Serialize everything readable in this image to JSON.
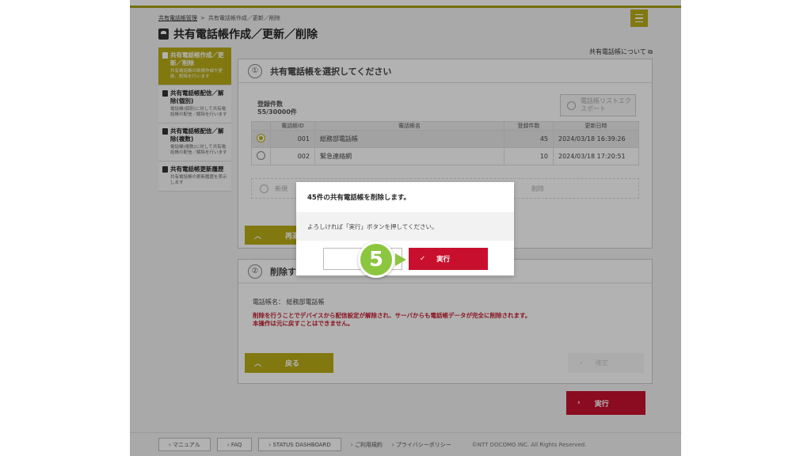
{
  "breadcrumb": {
    "root": "共有電話帳管理",
    "current": "共有電話帳作成／更新／削除"
  },
  "page": {
    "title": "共有電話帳作成／更新／削除"
  },
  "help_link": "共有電話帳について",
  "sidebar": {
    "items": [
      {
        "label": "共有電話帳作成／更新／削除",
        "desc": "共有電話帳の新規作成や更新、削除を行います",
        "active": true
      },
      {
        "label": "共有電話帳配信／解除(個別)",
        "desc": "電話機(個別)に対して共有電話帳の配信／解除を行います",
        "active": false
      },
      {
        "label": "共有電話帳配信／解除(複数)",
        "desc": "電話機(複数)に対して共有電話帳の配信／解除を行います",
        "active": false
      },
      {
        "label": "共有電話帳更新履歴",
        "desc": "共有電話帳の更新履歴を表示します",
        "active": false
      }
    ]
  },
  "panel1": {
    "step": "①",
    "title": "共有電話帳を選択してください",
    "count_title": "登録件数",
    "count_value": "55/30000件",
    "export_label": "電話帳リストエクスポート",
    "table": {
      "headers": [
        "電話帳ID",
        "電話帳名",
        "登録件数",
        "更新日時"
      ],
      "rows": [
        {
          "id": "001",
          "name": "総務部電話帳",
          "count": "45",
          "updated": "2024/03/18 16:39:26",
          "selected": true
        },
        {
          "id": "002",
          "name": "緊急連絡網",
          "count": "10",
          "updated": "2024/03/18 17:20:51",
          "selected": false
        }
      ]
    },
    "add_row_text": "新規",
    "add_row_delete": "削除",
    "search_button": "再選"
  },
  "panel2": {
    "step": "②",
    "title": "削除す",
    "book_label": "電話帳名：",
    "book_name": "総務部電話帳",
    "warning_line1": "削除を行うことでデバイスから配信設定が解除され、サーバからも電話帳データが完全に削除されます。",
    "warning_line2": "本操作は元に戻すことはできません。",
    "back_button": "戻る",
    "confirm_button": "確定"
  },
  "exec_button": "実行",
  "footer": {
    "manual": "マニュアル",
    "faq": "FAQ",
    "status": "STATUS DASHBOARD",
    "terms": "ご利用規約",
    "privacy": "プライバシーポリシー",
    "copyright": "©NTT DOCOMO INC. All Rights Reserved."
  },
  "dialog": {
    "title": "45件の共有電話帳を削除します。",
    "message": "よろしければ「実行」ボタンを押してください。",
    "cancel_label": "「",
    "ok_label": "実行"
  },
  "step_marker": "5",
  "colors": {
    "accent": "#b9ad18",
    "danger": "#c8102e",
    "marker": "#8cc63f"
  }
}
